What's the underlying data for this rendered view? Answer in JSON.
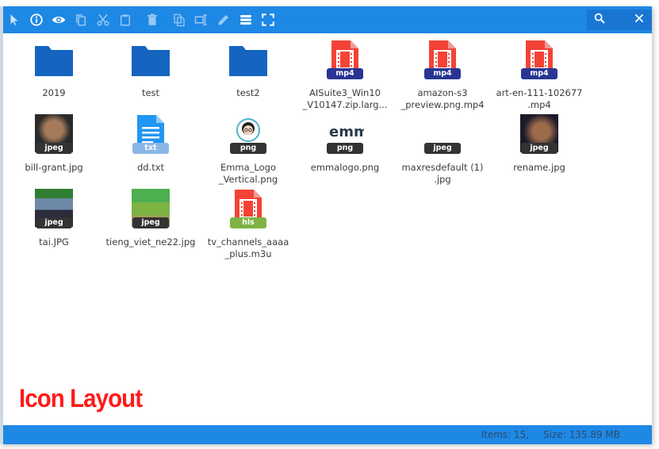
{
  "toolbar": {
    "icons": [
      "pointer-icon",
      "info-icon",
      "eye-icon",
      "copy-icon",
      "cut-icon",
      "paste-icon",
      "delete-icon",
      "duplicate-icon",
      "rename-icon",
      "edit-icon",
      "view-list-icon",
      "fullscreen-icon"
    ]
  },
  "colors": {
    "accent": "#1e88e5",
    "folder": "#1565c0",
    "video": "#f44336",
    "mp4_badge": "#283593",
    "image_badge": "#333333",
    "txt": "#2196f3",
    "hls_badge": "#7cb342",
    "watermark": "#ff1a1a"
  },
  "files": [
    {
      "name": "2019",
      "kind": "folder",
      "badge": ""
    },
    {
      "name": "test",
      "kind": "folder",
      "badge": ""
    },
    {
      "name": "test2",
      "kind": "folder",
      "badge": ""
    },
    {
      "name": "AISuite3_Win10\n_V10147.zip.larg...",
      "kind": "video",
      "badge": "mp4"
    },
    {
      "name": "amazon-s3\n_preview.png.mp4",
      "kind": "video",
      "badge": "mp4"
    },
    {
      "name": "art-en-111-102677\n.mp4",
      "kind": "video",
      "badge": "mp4"
    },
    {
      "name": "bill-grant.jpg",
      "kind": "image",
      "badge": "jpeg"
    },
    {
      "name": "dd.txt",
      "kind": "text",
      "badge": "txt"
    },
    {
      "name": "Emma_Logo\n_Vertical.png",
      "kind": "image",
      "badge": "png"
    },
    {
      "name": "emmalogo.png",
      "kind": "image",
      "badge": "png"
    },
    {
      "name": "maxresdefault (1)\n.jpg",
      "kind": "image",
      "badge": "jpeg"
    },
    {
      "name": "rename.jpg",
      "kind": "image",
      "badge": "jpeg"
    },
    {
      "name": "tai.JPG",
      "kind": "image",
      "badge": "jpeg"
    },
    {
      "name": "tieng_viet_ne22.jpg",
      "kind": "image",
      "badge": "jpeg"
    },
    {
      "name": "tv_channels_aaaa\n_plus.m3u",
      "kind": "stream",
      "badge": "hls"
    }
  ],
  "thumb_text": {
    "emmalogo": "emm"
  },
  "watermark": "Icon Layout",
  "status": {
    "items": "Items: 15,",
    "size": "Size: 135.89 MB"
  }
}
